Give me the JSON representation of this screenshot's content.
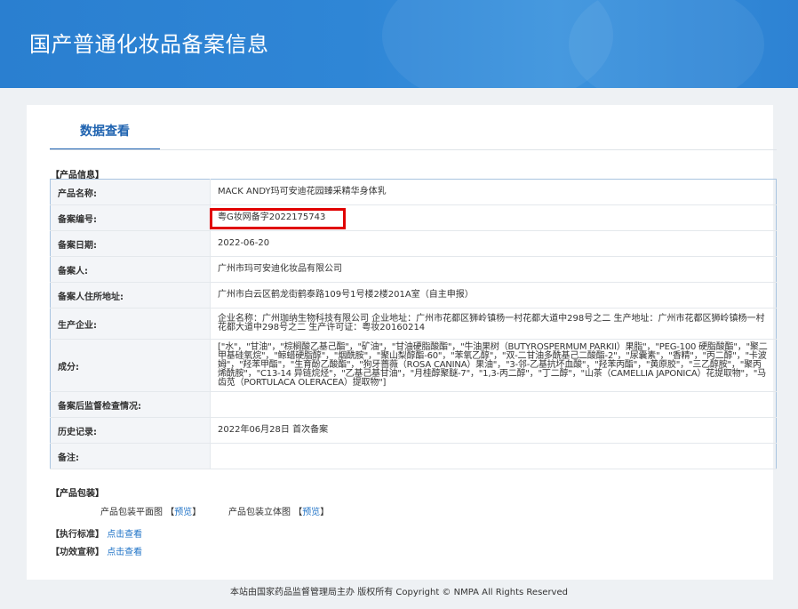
{
  "header": {
    "title": "国产普通化妆品备案信息"
  },
  "tab": {
    "label": "数据查看"
  },
  "product_info": {
    "section_label": "【产品信息】",
    "rows": [
      {
        "key": "产品名称:",
        "value": "MACK ANDY玛可安迪花园臻采精华身体乳"
      },
      {
        "key": "备案编号:",
        "value": "粤G妆网备字2022175743"
      },
      {
        "key": "备案日期:",
        "value": "2022-06-20"
      },
      {
        "key": "备案人:",
        "value": "广州市玛可安迪化妆品有限公司"
      },
      {
        "key": "备案人住所地址:",
        "value": "广州市白云区鹤龙街鹤泰路109号1号楼2楼201A室（自主申报）"
      },
      {
        "key": "生产企业:",
        "value": "企业名称：广州珈纳生物科技有限公司 企业地址：广州市花都区狮岭镇杨一村花都大道中298号之二 生产地址：广州市花都区狮岭镇杨一村花都大道中298号之二 生产许可证：粤妆20160214"
      },
      {
        "key": "成分:",
        "value": "[\"水\"，\"甘油\"，\"棕榈酸乙基己酯\"，\"矿油\"，\"甘油硬脂酸酯\"，\"牛油果树（BUTYROSPERMUM PARKII）果脂\"，\"PEG-100 硬脂酸酯\"，\"聚二甲基硅氧烷\"，\"鲸蜡硬脂醇\"，\"烟酰胺\"，\"聚山梨醇酯-60\"，\"苯氧乙醇\"，\"双-二甘油多酰基己二酸酯-2\"，\"尿囊素\"，\"香精\"，\"丙二醇\"，\"卡波姆\"，\"羟苯甲酯\"，\"生育酚乙酸酯\"，\"狗牙蔷薇（ROSA CANINA）果油\"，\"3-邻-乙基抗坏血酸\"，\"羟苯丙酯\"，\"黄原胶\"，\"三乙醇胺\"，\"聚丙烯酰胺\"，\"C13-14 异链烷烃\"，\"乙基己基甘油\"，\"月桂醇聚醚-7\"，\"1,3-丙二醇\"，\"丁二醇\"，\"山茶（CAMELLIA JAPONICA）花提取物\"，\"马齿苋（PORTULACA OLERACEA）提取物\"]"
      },
      {
        "key": "备案后监督检查情况:",
        "value": ""
      },
      {
        "key": "历史记录:",
        "value": "2022年06月28日 首次备案"
      },
      {
        "key": "备注:",
        "value": ""
      }
    ]
  },
  "packaging": {
    "section_label": "【产品包装】",
    "flat_label": "产品包装平面图",
    "flat_link": "预览",
    "solid_label": "产品包装立体图",
    "solid_link": "预览",
    "bracket_open": "【",
    "bracket_close": "】"
  },
  "standards": {
    "label": "【执行标准】",
    "link": "点击查看"
  },
  "claims": {
    "label": "【功效宣称】",
    "link": "点击查看"
  },
  "footer": {
    "text": "本站由国家药品监督管理局主办 版权所有 Copyright © NMPA All Rights Reserved"
  },
  "colors": {
    "banner": "#2f86d6",
    "accent": "#1f63b0",
    "highlight": "#e00000"
  }
}
